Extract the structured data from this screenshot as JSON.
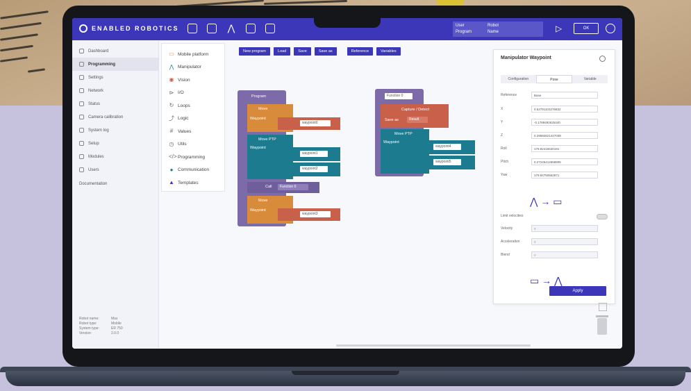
{
  "app": {
    "brand": "ENABLED ROBOTICS",
    "user_info": {
      "k1": "User",
      "v1": "Robot",
      "k2": "Program",
      "v2": "Name"
    },
    "ok_label": "OK"
  },
  "sidebar": {
    "items": [
      {
        "label": "Dashboard",
        "active": false
      },
      {
        "label": "Programming",
        "active": true
      },
      {
        "label": "Settings",
        "active": false
      },
      {
        "label": "Network",
        "active": false
      },
      {
        "label": "Status",
        "active": false
      },
      {
        "label": "Camera calibration",
        "active": false
      },
      {
        "label": "System log",
        "active": false
      },
      {
        "label": "Setup",
        "active": false
      },
      {
        "label": "Modules",
        "active": false
      },
      {
        "label": "Users",
        "active": false
      }
    ],
    "documentation": "Documentation",
    "meta": [
      {
        "k": "Robot name:",
        "v": "Max"
      },
      {
        "k": "Robot type:",
        "v": "Mobile"
      },
      {
        "k": "System type:",
        "v": "ER 750"
      },
      {
        "k": "Version:",
        "v": "2.0.0"
      }
    ]
  },
  "toolbox": {
    "items": [
      {
        "label": "Mobile platform",
        "icon": "mobile-platform-icon",
        "glyph": "▭",
        "color": "#d98b3c"
      },
      {
        "label": "Manipulator",
        "icon": "manipulator-icon",
        "glyph": "⋀",
        "color": "#1c7b8e"
      },
      {
        "label": "Vision",
        "icon": "vision-icon",
        "glyph": "◉",
        "color": "#c9604a"
      },
      {
        "label": "I/O",
        "icon": "io-icon",
        "glyph": "⊳",
        "color": "#666"
      },
      {
        "label": "Loops",
        "icon": "loops-icon",
        "glyph": "↻",
        "color": "#666"
      },
      {
        "label": "Logic",
        "icon": "logic-icon",
        "glyph": "⤴",
        "color": "#666"
      },
      {
        "label": "Values",
        "icon": "values-icon",
        "glyph": "#",
        "color": "#666"
      },
      {
        "label": "Utils",
        "icon": "utils-icon",
        "glyph": "◷",
        "color": "#666"
      },
      {
        "label": "Programming",
        "icon": "programming-icon",
        "glyph": "</>",
        "color": "#666"
      },
      {
        "label": "Communication",
        "icon": "communication-icon",
        "glyph": "●",
        "color": "#1c7b8e"
      },
      {
        "label": "Templates",
        "icon": "templates-icon",
        "glyph": "▲",
        "color": "#3b37b8"
      }
    ]
  },
  "toolbar": {
    "buttons": [
      "New program",
      "Load",
      "Save",
      "Save as",
      "Reference",
      "Variables"
    ]
  },
  "blocks": {
    "program": "Program",
    "move1": "Move",
    "waypoint": "Waypoint",
    "wp_field1": "waypoint0",
    "move_ptp": "Move PTP",
    "wp_field2": "waypoint1",
    "wp_field3": "waypoint2",
    "call": "Call",
    "call_field": "Function 0",
    "move2": "Move",
    "wp_field4": "waypoint3",
    "function_field": "Function 0",
    "capture": "Capture / Detect",
    "save_as": "Save as",
    "save_as_field": "Result",
    "move_ptp2": "Move PTP",
    "wp_field5": "waypoint4",
    "wp_field6": "waypoint5"
  },
  "panel": {
    "title": "Manipulator Waypoint",
    "tabs": [
      {
        "label": "Configuration",
        "selected": false
      },
      {
        "label": "Pose",
        "selected": true
      },
      {
        "label": "Variable",
        "selected": false
      }
    ],
    "reference": {
      "label": "Reference",
      "value": "Base"
    },
    "coords": [
      {
        "label": "X",
        "value": "0.52791103276832"
      },
      {
        "label": "Y",
        "value": "-0.1789492625440"
      },
      {
        "label": "Z",
        "value": "0.29584621447038"
      },
      {
        "label": "Roll",
        "value": "179.82416630191"
      },
      {
        "label": "Pitch",
        "value": "0.27245412658805"
      },
      {
        "label": "Yaw",
        "value": "179.94750562871"
      }
    ],
    "limits_label": "Limit velocities",
    "limits": [
      {
        "label": "Velocity",
        "value": "0"
      },
      {
        "label": "Acceleration",
        "value": "0"
      },
      {
        "label": "Blend",
        "value": "0"
      }
    ],
    "apply_label": "Apply"
  }
}
